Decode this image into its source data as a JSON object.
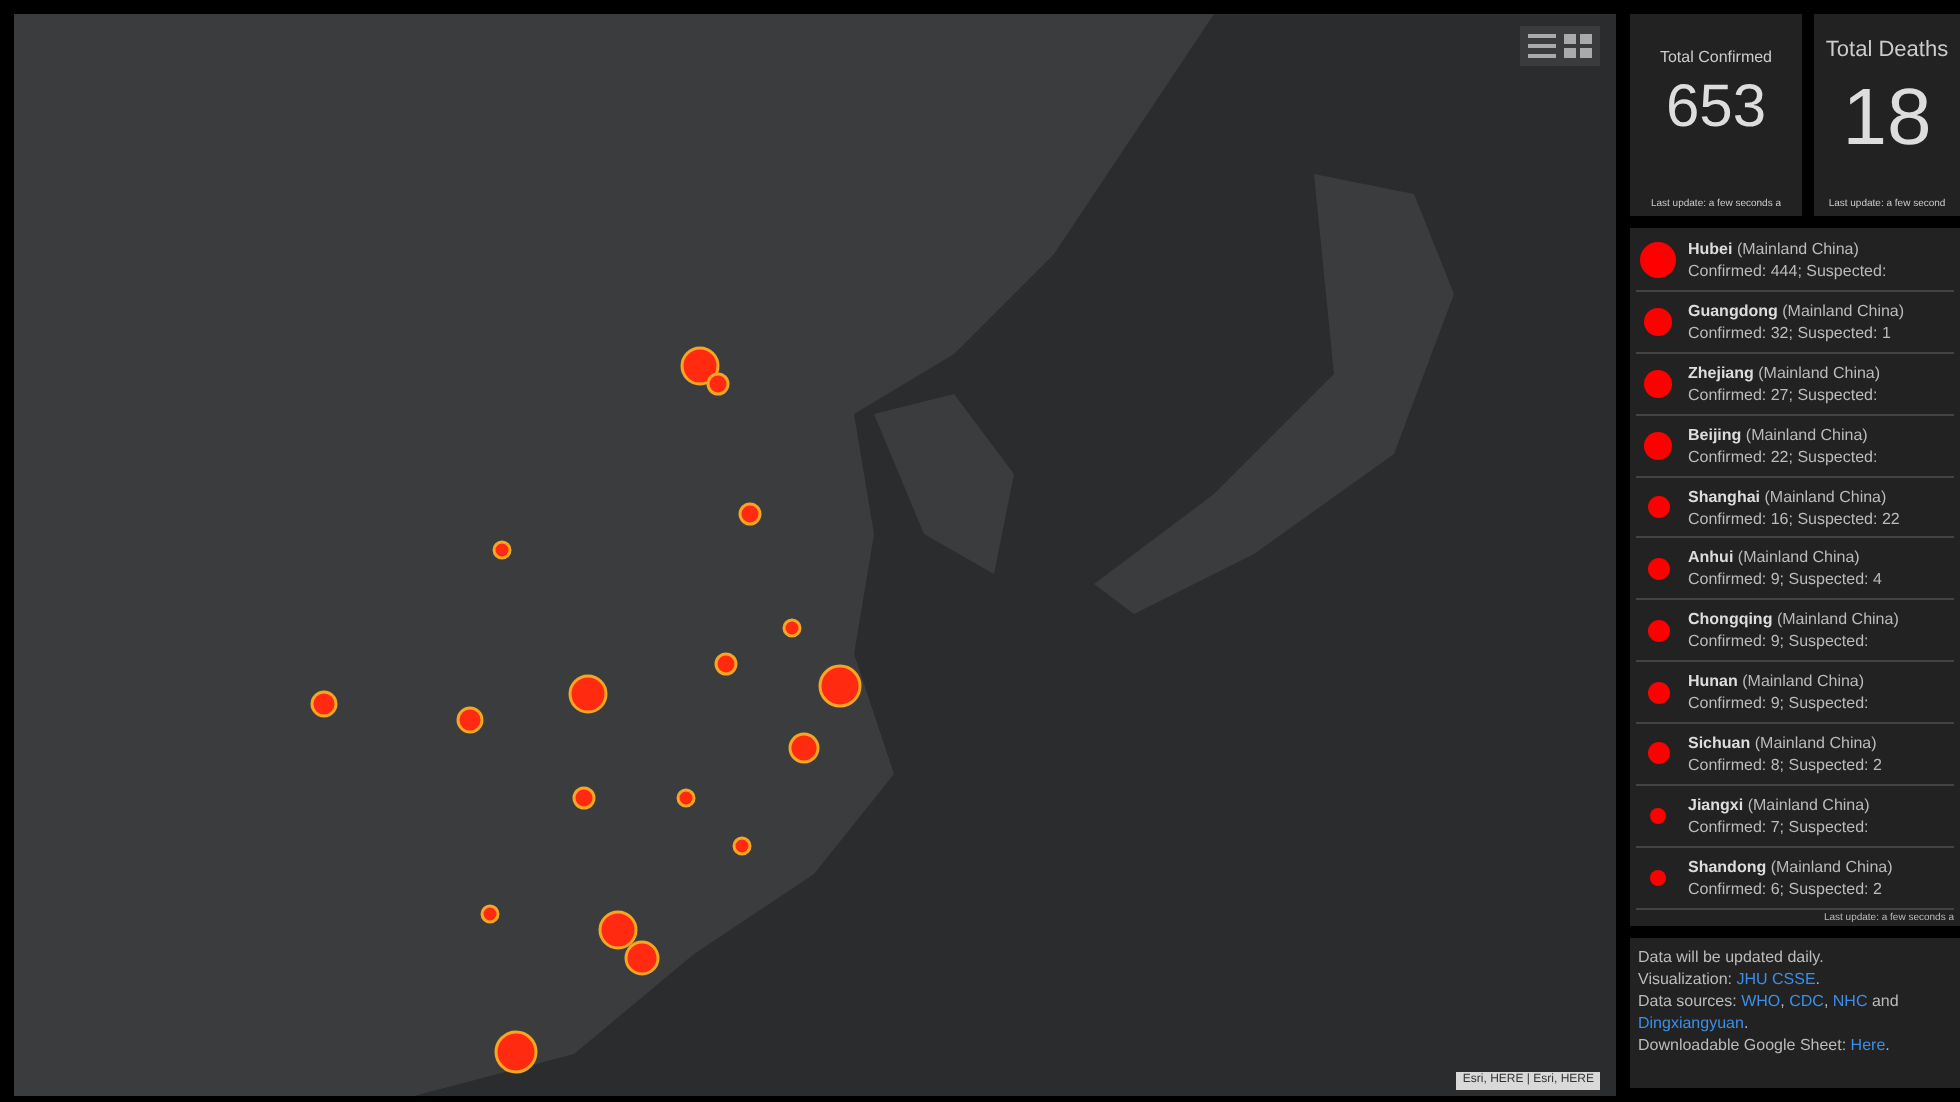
{
  "map": {
    "attribution": "Esri, HERE | Esri, HERE"
  },
  "stats": [
    {
      "label": "Total Confirmed",
      "value": "653",
      "updated": "Last update: a few seconds a"
    },
    {
      "label": "Total Deaths",
      "value": "18",
      "updated": "Last update: a few second"
    }
  ],
  "regions": [
    {
      "name": "Hubei",
      "area": "(Mainland China)",
      "detail": "Confirmed: 444; Suspected:",
      "kind": "large"
    },
    {
      "name": "Guangdong",
      "area": "(Mainland China)",
      "detail": "Confirmed: 32; Suspected: 1",
      "kind": "medium"
    },
    {
      "name": "Zhejiang",
      "area": "(Mainland China)",
      "detail": "Confirmed: 27; Suspected:",
      "kind": "medium"
    },
    {
      "name": "Beijing",
      "area": "(Mainland China)",
      "detail": "Confirmed: 22; Suspected:",
      "kind": "medium"
    },
    {
      "name": "Shanghai",
      "area": "(Mainland China)",
      "detail": "Confirmed: 16; Suspected: 22",
      "kind": "small"
    },
    {
      "name": "Anhui",
      "area": "(Mainland China)",
      "detail": "Confirmed: 9; Suspected: 4",
      "kind": "small"
    },
    {
      "name": "Chongqing",
      "area": "(Mainland China)",
      "detail": "Confirmed: 9; Suspected:",
      "kind": "small"
    },
    {
      "name": "Hunan",
      "area": "(Mainland China)",
      "detail": "Confirmed: 9; Suspected:",
      "kind": "small"
    },
    {
      "name": "Sichuan",
      "area": "(Mainland China)",
      "detail": "Confirmed: 8; Suspected: 2",
      "kind": "small"
    },
    {
      "name": "Jiangxi",
      "area": "(Mainland China)",
      "detail": "Confirmed: 7; Suspected:",
      "kind": "tiny"
    },
    {
      "name": "Shandong",
      "area": "(Mainland China)",
      "detail": "Confirmed: 6; Suspected: 2",
      "kind": "tiny"
    }
  ],
  "list_updated": "Last update: a few seconds a",
  "notes": [
    {
      "parts": [
        {
          "text": "Data will be updated daily."
        }
      ]
    },
    {
      "parts": [
        {
          "text": "Visualization: "
        },
        {
          "text": "JHU CSSE",
          "link": true
        },
        {
          "text": "."
        }
      ]
    },
    {
      "parts": [
        {
          "text": "Data sources: "
        },
        {
          "text": "WHO",
          "link": true
        },
        {
          "text": ", "
        },
        {
          "text": "CDC",
          "link": true
        },
        {
          "text": ", "
        },
        {
          "text": "NHC",
          "link": true
        },
        {
          "text": " and "
        },
        {
          "text": "Dingxiangyuan",
          "link": true
        },
        {
          "text": "."
        }
      ]
    },
    {
      "parts": [
        {
          "text": "Downloadable Google Sheet: "
        },
        {
          "text": "Here",
          "link": true
        },
        {
          "text": "."
        }
      ]
    }
  ]
}
